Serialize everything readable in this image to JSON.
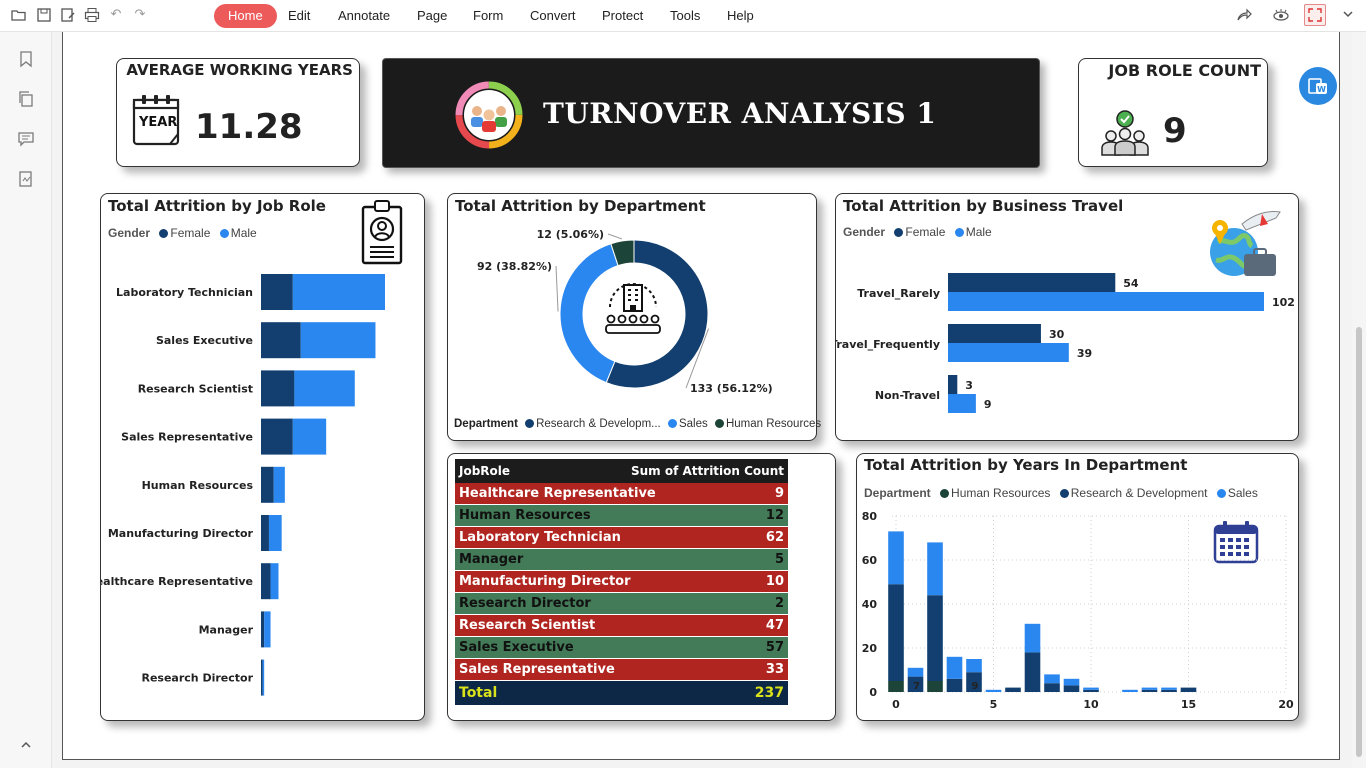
{
  "menubar": {
    "tabs": [
      "Home",
      "Edit",
      "Annotate",
      "Page",
      "Form",
      "Convert",
      "Protect",
      "Tools",
      "Help"
    ],
    "active_tab": "Home"
  },
  "kpis": {
    "avg_years": {
      "title": "AVERAGE WORKING YEARS",
      "value": "11.28",
      "calendar_word": "YEAR"
    },
    "job_role_count": {
      "title": "JOB ROLE COUNT",
      "value": "9"
    }
  },
  "banner": {
    "title": "TURNOVER ANALYSIS 1"
  },
  "colors": {
    "female": "#123f6f",
    "male": "#2a87f0",
    "human_resources": "#1d4438",
    "research_development": "#123f6f",
    "sales": "#2a87f0",
    "table_red": "#b0251f",
    "table_green": "#437a57",
    "active_tab": "#ec5a5a"
  },
  "chart_data": [
    {
      "type": "bar",
      "orientation": "horizontal",
      "stacked": true,
      "title": "Total Attrition by Job Role",
      "legend_title": "Gender",
      "categories": [
        "Laboratory Technician",
        "Sales Executive",
        "Research Scientist",
        "Sales Representative",
        "Human Resources",
        "Manufacturing Director",
        "Healthcare Representative",
        "Manager",
        "Research Director"
      ],
      "series": [
        {
          "name": "Female",
          "values": [
            20,
            25,
            21,
            20,
            8,
            5,
            6,
            2,
            1
          ]
        },
        {
          "name": "Male",
          "values": [
            58,
            47,
            38,
            21,
            7,
            8,
            5,
            4,
            1
          ]
        }
      ],
      "xlim": [
        0,
        80
      ]
    },
    {
      "type": "pie",
      "donut": true,
      "title": "Total Attrition by Department",
      "legend_title": "Department",
      "categories": [
        "Research & Developm...",
        "Sales",
        "Human Resources"
      ],
      "values": [
        133,
        92,
        12
      ],
      "labels": [
        "133 (56.12%)",
        "92 (38.82%)",
        "12 (5.06%)"
      ]
    },
    {
      "type": "bar",
      "orientation": "horizontal",
      "grouped": true,
      "title": "Total Attrition by Business Travel",
      "legend_title": "Gender",
      "categories": [
        "Travel_Rarely",
        "Travel_Frequently",
        "Non-Travel"
      ],
      "series": [
        {
          "name": "Female",
          "values": [
            54,
            30,
            3
          ]
        },
        {
          "name": "Male",
          "values": [
            102,
            39,
            9
          ]
        }
      ],
      "xlim": [
        0,
        102
      ]
    },
    {
      "type": "table",
      "columns": [
        "JobRole",
        "Sum of Attrition Count"
      ],
      "rows": [
        [
          "Healthcare Representative",
          "9"
        ],
        [
          "Human Resources",
          "12"
        ],
        [
          "Laboratory Technician",
          "62"
        ],
        [
          "Manager",
          "5"
        ],
        [
          "Manufacturing Director",
          "10"
        ],
        [
          "Research Director",
          "2"
        ],
        [
          "Research Scientist",
          "47"
        ],
        [
          "Sales Executive",
          "57"
        ],
        [
          "Sales Representative",
          "33"
        ]
      ],
      "total": [
        "Total",
        "237"
      ]
    },
    {
      "type": "bar",
      "stacked": true,
      "title": "Total Attrition by Years In Department",
      "legend_title": "Department",
      "x": [
        0,
        1,
        2,
        3,
        4,
        5,
        6,
        7,
        8,
        9,
        10,
        12,
        13,
        14,
        15
      ],
      "series": [
        {
          "name": "Human Resources",
          "values": [
            5,
            0,
            5,
            0,
            0,
            0,
            0,
            0,
            0,
            0,
            0,
            0,
            0,
            0,
            0
          ]
        },
        {
          "name": "Research & Development",
          "values": [
            44,
            7,
            39,
            6,
            9,
            0,
            2,
            18,
            4,
            3,
            1,
            0,
            1,
            1,
            2
          ]
        },
        {
          "name": "Sales",
          "values": [
            24,
            4,
            24,
            10,
            6,
            1,
            0,
            13,
            4,
            3,
            1,
            1,
            1,
            1,
            0
          ]
        }
      ],
      "data_labels": [
        {
          "x": 1,
          "text": "7"
        },
        {
          "x": 4,
          "text": "9"
        }
      ],
      "xticks": [
        "0",
        "5",
        "10",
        "15",
        "20"
      ],
      "yticks": [
        "0",
        "20",
        "40",
        "60",
        "80"
      ],
      "xlim": [
        0,
        20
      ],
      "ylim": [
        0,
        80
      ],
      "grid": true
    }
  ]
}
